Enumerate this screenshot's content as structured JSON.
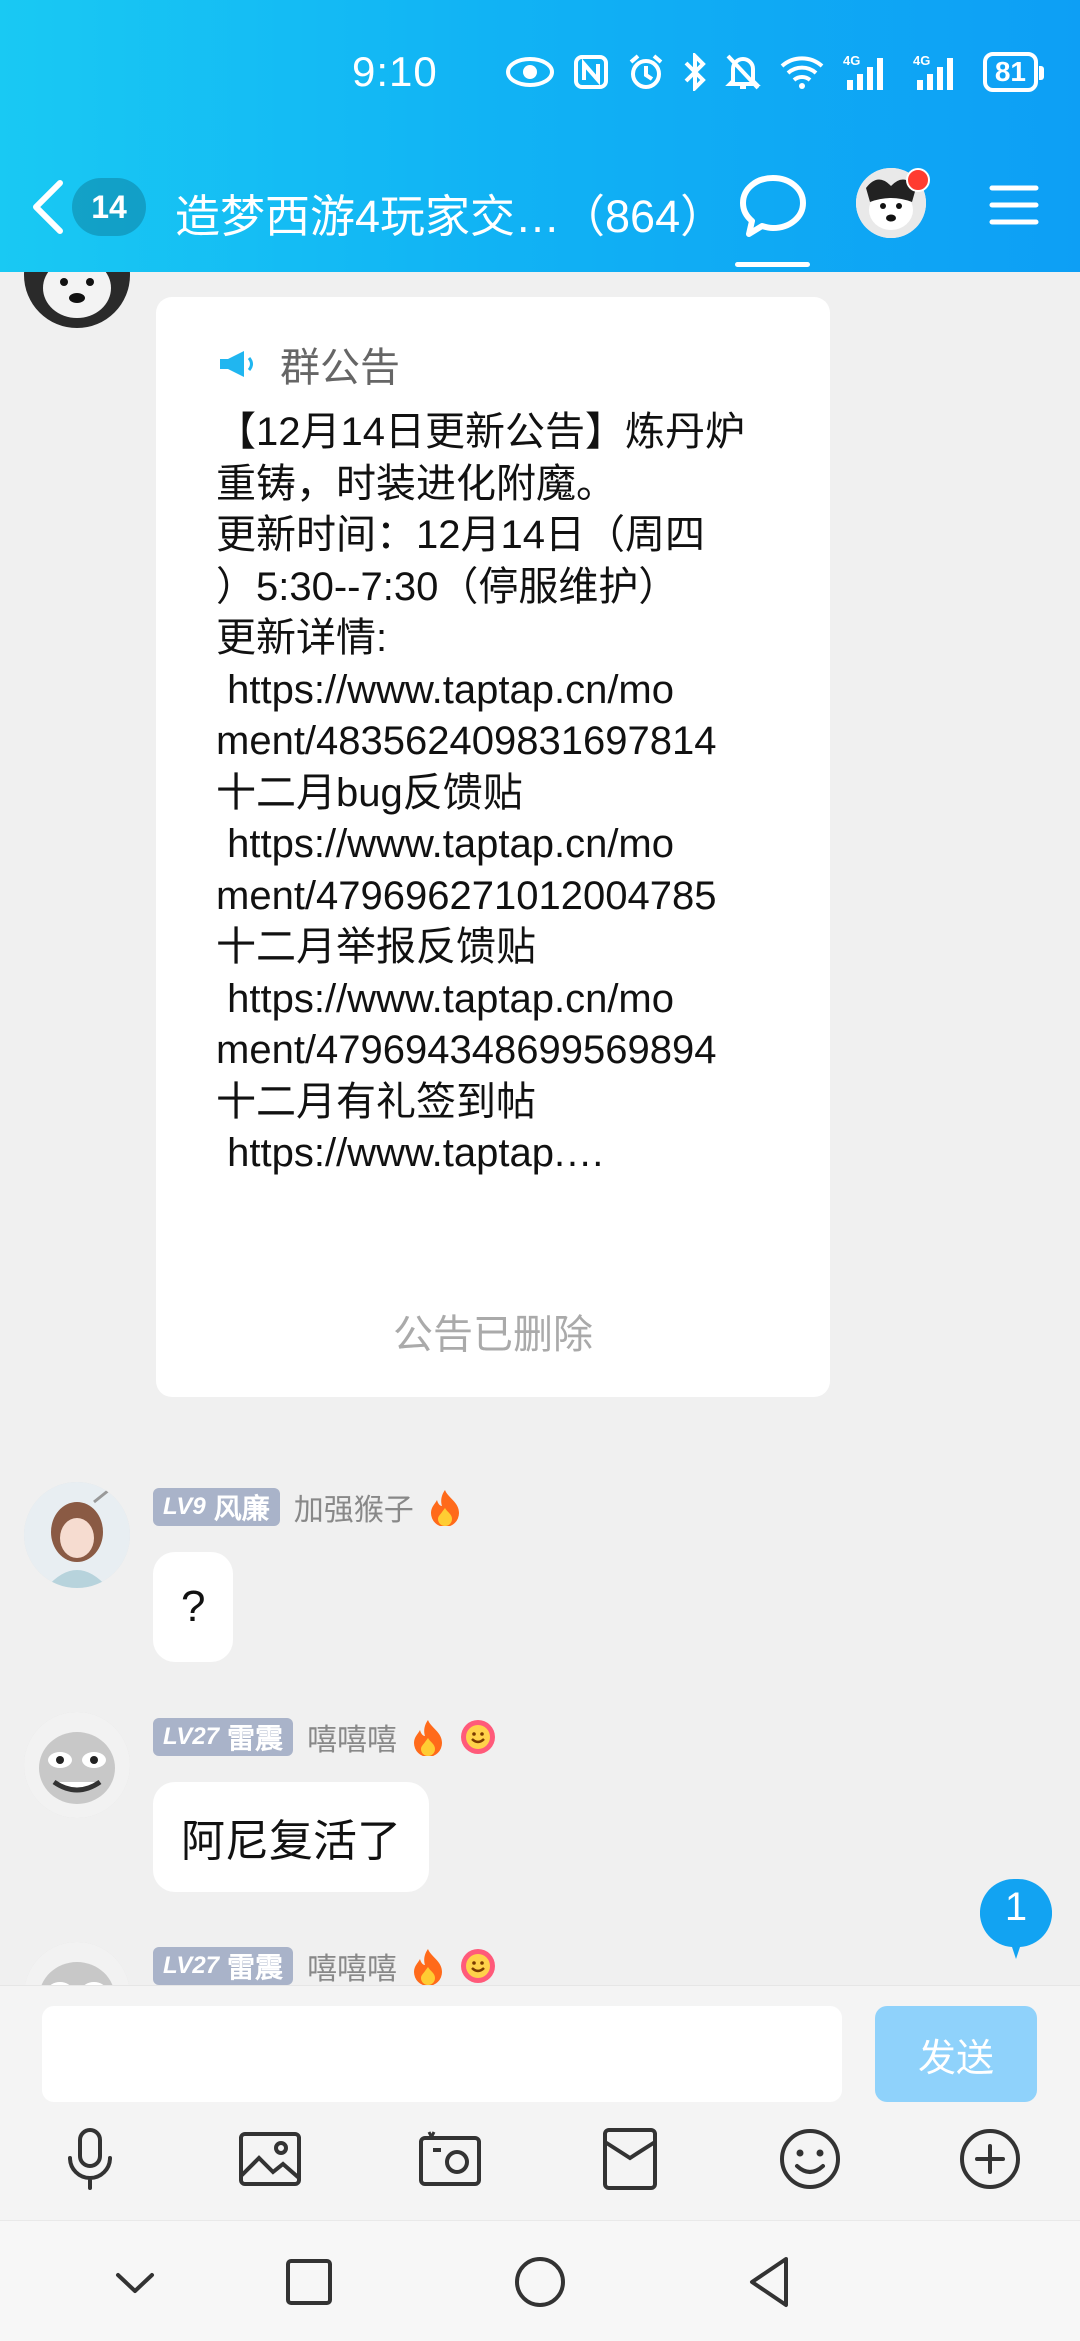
{
  "status_bar": {
    "time": "9:10",
    "battery": "81",
    "icons": [
      "eye-icon",
      "nfc-icon",
      "alarm-icon",
      "bluetooth-icon",
      "mute-bell-icon",
      "wifi-icon",
      "signal-4g-icon",
      "signal-4g-icon"
    ],
    "network_label_1": "4G",
    "network_label_2": "4G"
  },
  "header": {
    "unread_count": "14",
    "title": "造梦西游4玩家交…（864）",
    "accent_color": "#12aef4"
  },
  "announcement": {
    "label": "群公告",
    "body": "【12月14日更新公告】炼丹炉\n重铸，时装进化附魔。\n更新时间：12月14日（周四\n）5:30--7:30（停服维护）\n更新详情:\n https://www.taptap.cn/mo\nment/483562409831697814\n十二月bug反馈贴\n https://www.taptap.cn/mo\nment/479696271012004785\n十二月举报反馈贴\n https://www.taptap.cn/mo\nment/479694348699569894\n十二月有礼签到帖\n https://www.taptap.…",
    "deleted_note": "公告已删除"
  },
  "messages": [
    {
      "level": "LV9",
      "title": "风廉",
      "nickname": "加强猴子",
      "text": "?",
      "badges": [
        "fire-icon"
      ]
    },
    {
      "level": "LV27",
      "title": "雷震",
      "nickname": "嘻嘻嘻",
      "text": "阿尼复活了",
      "badges": [
        "fire-icon",
        "smile-flower-icon"
      ]
    },
    {
      "level": "LV27",
      "title": "雷震",
      "nickname": "嘻嘻嘻",
      "text": "",
      "badges": [
        "fire-icon",
        "smile-flower-icon"
      ]
    }
  ],
  "new_message_badge": "1",
  "input": {
    "placeholder": "",
    "send_label": "发送"
  },
  "toolbar": [
    "microphone-icon",
    "image-icon",
    "camera-icon",
    "red-packet-icon",
    "emoji-icon",
    "plus-icon"
  ],
  "navbar": [
    "chevron-down-icon",
    "square-recent-icon",
    "circle-home-icon",
    "triangle-back-icon"
  ]
}
